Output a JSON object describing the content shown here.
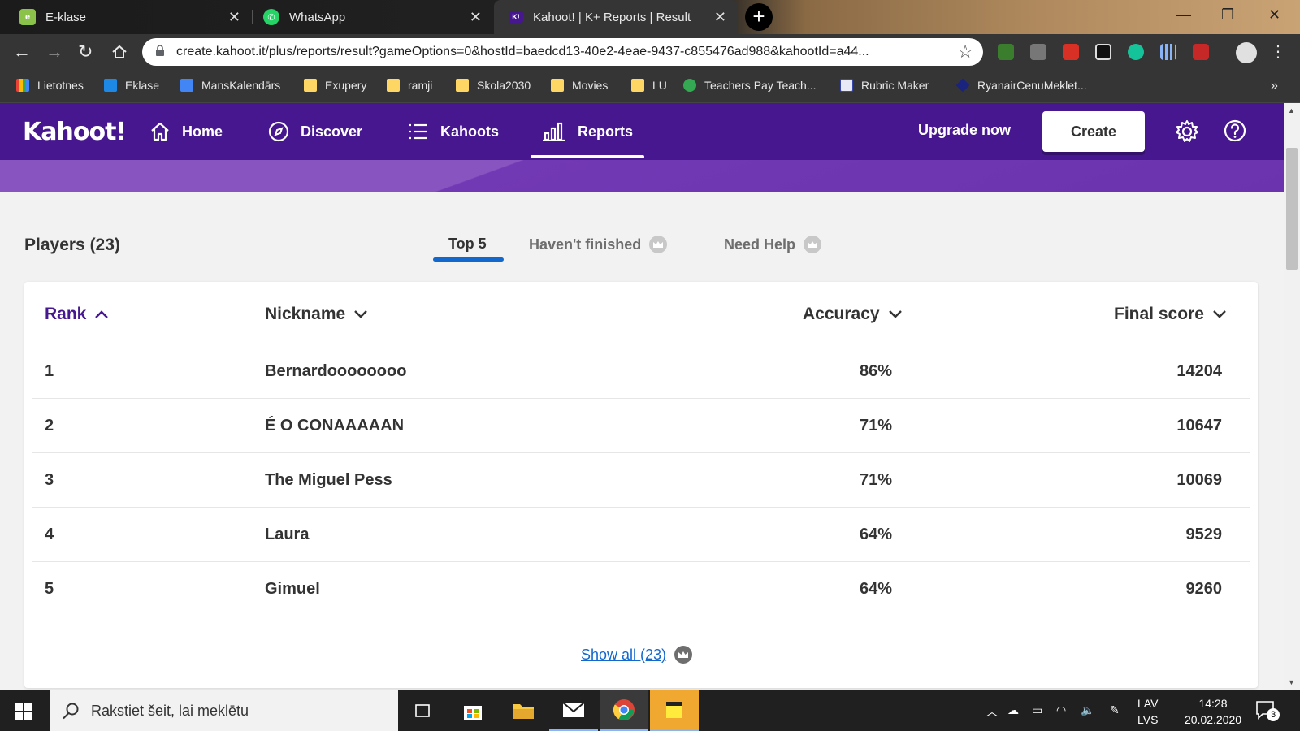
{
  "browser": {
    "tabs": [
      {
        "title": "E-klase",
        "icon": "e-klase-icon",
        "color": "#8bc34a"
      },
      {
        "title": "WhatsApp",
        "icon": "whatsapp-icon",
        "color": "#25d366"
      },
      {
        "title": "Kahoot! | K+ Reports | Result",
        "icon": "kahoot-icon",
        "color": "#46178f"
      }
    ],
    "new_tab": "+",
    "url": "create.kahoot.it/plus/reports/result?gameOptions=0&hostId=baedcd13-40e2-4eae-9437-c855476ad988&kahootId=a44...",
    "bookmarks": [
      {
        "label": "Lietotnes",
        "icon": "apps-grid-icon"
      },
      {
        "label": "Eklase",
        "icon": "eklase-icon"
      },
      {
        "label": "MansKalendārs",
        "icon": "calendar-icon"
      },
      {
        "label": "Exupery",
        "icon": "folder-icon"
      },
      {
        "label": "ramji",
        "icon": "folder-icon"
      },
      {
        "label": "Skola2030",
        "icon": "folder-icon"
      },
      {
        "label": "Movies",
        "icon": "folder-icon"
      },
      {
        "label": "LU",
        "icon": "folder-icon"
      },
      {
        "label": "Teachers Pay Teach...",
        "icon": "tpt-icon"
      },
      {
        "label": "Rubric Maker",
        "icon": "rubric-icon"
      },
      {
        "label": "RyanairCenuMeklet...",
        "icon": "ryanair-icon"
      }
    ],
    "more_bookmarks": "»"
  },
  "kahoot": {
    "logo": "Kahoot!",
    "nav": [
      {
        "label": "Home",
        "icon": "home-icon"
      },
      {
        "label": "Discover",
        "icon": "compass-icon"
      },
      {
        "label": "Kahoots",
        "icon": "list-icon"
      },
      {
        "label": "Reports",
        "icon": "bar-chart-icon"
      }
    ],
    "upgrade": "Upgrade now",
    "create": "Create",
    "colors": {
      "header": "#46178f",
      "accent": "#1368ce"
    }
  },
  "report": {
    "players_title": "Players (23)",
    "filter_tabs": [
      {
        "label": "Top 5",
        "premium": false
      },
      {
        "label": "Haven't finished",
        "premium": true
      },
      {
        "label": "Need Help",
        "premium": true
      }
    ],
    "columns": {
      "rank": "Rank",
      "nickname": "Nickname",
      "accuracy": "Accuracy",
      "final_score": "Final score"
    },
    "rows": [
      {
        "rank": "1",
        "nickname": "Bernardoooooooo",
        "accuracy": "86%",
        "score": "14204"
      },
      {
        "rank": "2",
        "nickname": "É O CONAAAAAN",
        "accuracy": "71%",
        "score": "10647"
      },
      {
        "rank": "3",
        "nickname": "The Miguel Pess",
        "accuracy": "71%",
        "score": "10069"
      },
      {
        "rank": "4",
        "nickname": "Laura",
        "accuracy": "64%",
        "score": "9529"
      },
      {
        "rank": "5",
        "nickname": "Gimuel",
        "accuracy": "64%",
        "score": "9260"
      }
    ],
    "show_all": "Show all (23)"
  },
  "taskbar": {
    "search_placeholder": "Rakstiet šeit, lai meklētu",
    "lang_top": "LAV",
    "lang_bottom": "LVS",
    "time": "14:28",
    "date": "20.02.2020",
    "notifications": "3"
  }
}
